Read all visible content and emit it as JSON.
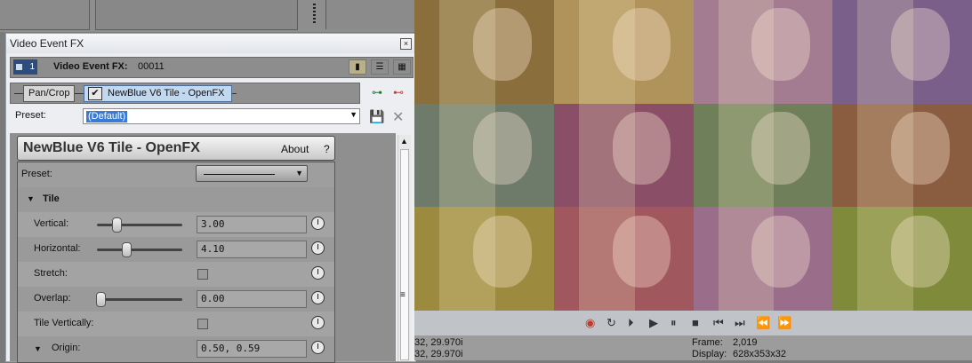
{
  "dialog": {
    "title": "Video Event FX",
    "track_number": "1",
    "event_label": "Video Event FX:",
    "event_id": "00011",
    "chain": {
      "fx1": "Pan/Crop",
      "fx2": "NewBlue V6 Tile - OpenFX"
    },
    "preset_label": "Preset:",
    "preset_value": "(Default)"
  },
  "plugin": {
    "title": "NewBlue V6 Tile - OpenFX",
    "about": "About",
    "help": "?",
    "preset_label": "Preset:",
    "section": "Tile",
    "params": {
      "vertical": {
        "label": "Vertical:",
        "value": "3.00",
        "slider": 0.2
      },
      "horizontal": {
        "label": "Horizontal:",
        "value": "4.10",
        "slider": 0.32
      },
      "stretch": {
        "label": "Stretch:"
      },
      "overlap": {
        "label": "Overlap:",
        "value": "0.00",
        "slider": 0.0
      },
      "tile_vertically": {
        "label": "Tile Vertically:"
      },
      "origin": {
        "label": "Origin:",
        "value": "0.50, 0.59"
      }
    }
  },
  "preview": {
    "tile_colors": [
      "#8a6f3d",
      "#b0935a",
      "#a47c92",
      "#7a5f8a",
      "#6e7a6a",
      "#8a4f66",
      "#6f7f5a",
      "#8a5c40",
      "#9c8a3e",
      "#a0575e",
      "#9a6e8a",
      "#7f8a3a"
    ]
  },
  "status": {
    "left1": "32, 29.970i",
    "left2": "32, 29.970i",
    "frame_label": "Frame:",
    "frame_value": "2,019",
    "display_label": "Display:",
    "display_value": "628x353x32"
  }
}
